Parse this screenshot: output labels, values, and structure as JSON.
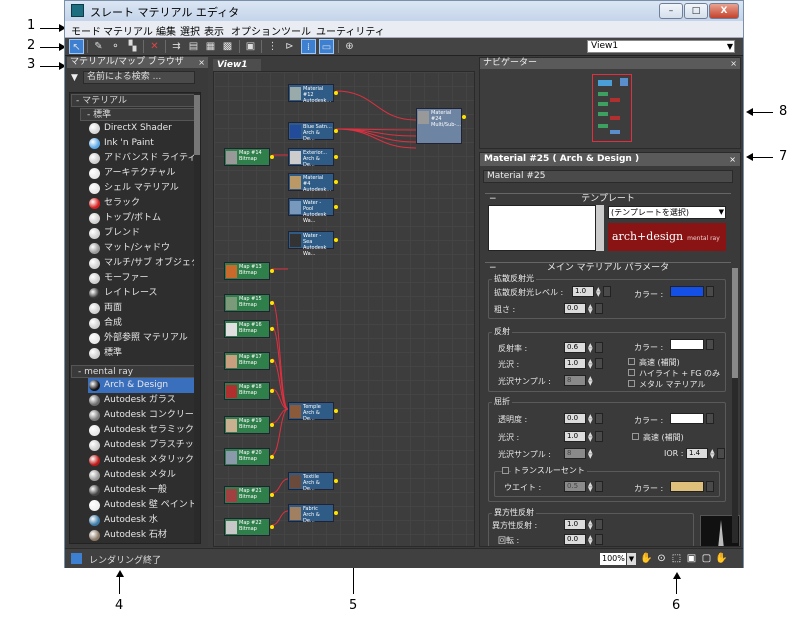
{
  "window": {
    "title": "スレート マテリアル エディタ",
    "buttons": {
      "minimize": "–",
      "maximize": "□",
      "close": "X"
    }
  },
  "menu": [
    "モード",
    "マテリアル",
    "編集",
    "選択",
    "表示",
    "オプション",
    "ツール",
    "ユーティリティ"
  ],
  "toolbar": {
    "icons": [
      "select-icon",
      "eyedropper-icon",
      "assign-icon",
      "pick-icon",
      "delete-icon",
      "move-children-icon",
      "hide-unused-icon",
      "layout-icon",
      "checker-icon",
      "background-icon",
      "show-map-icon",
      "show-end-icon",
      "parameter-icon",
      "zoom-select-icon"
    ],
    "view_select": "View1"
  },
  "browser": {
    "title": "マテリアル/マップ ブラウザ",
    "search_placeholder": "名前による検索 ...",
    "materials_group": "- マテリアル",
    "standard_group": "- 標準",
    "standard_items": [
      {
        "label": "DirectX Shader",
        "color": "#d7d7d7"
      },
      {
        "label": "Ink 'n Paint",
        "color": "#5aa8e6"
      },
      {
        "label": "アドバンスド ライティ...",
        "color": "#cfcfcf"
      },
      {
        "label": "アーキテクチャル",
        "color": "#e8e8e8"
      },
      {
        "label": "シェル マテリアル",
        "color": "#e8e8e8"
      },
      {
        "label": "セラック",
        "color": "#d81e1e"
      },
      {
        "label": "トップ/ボトム",
        "color": "#d0d0d0"
      },
      {
        "label": "ブレンド",
        "color": "#d0d0d0"
      },
      {
        "label": "マット/シャドウ",
        "color": "#9a9a9a"
      },
      {
        "label": "マルチ/サブ オブジェクト",
        "color": "#d0d0d0"
      },
      {
        "label": "モーファー",
        "color": "#d0d0d0"
      },
      {
        "label": "レイトレース",
        "color": "#333333"
      },
      {
        "label": "両面",
        "color": "#d0d0d0"
      },
      {
        "label": "合成",
        "color": "#d0d0d0"
      },
      {
        "label": "外部参照 マテリアル",
        "color": "#e8e8e8"
      },
      {
        "label": "標準",
        "color": "#cfcfcf"
      }
    ],
    "mr_group": "- mental ray",
    "mr_items": [
      {
        "label": "Arch & Design",
        "color": "#111111"
      },
      {
        "label": "Autodesk ガラス",
        "color": "#6a6a6a"
      },
      {
        "label": "Autodesk コンクリート",
        "color": "#7a7a7a"
      },
      {
        "label": "Autodesk セラミック",
        "color": "#e8e8e8"
      },
      {
        "label": "Autodesk プラスチッ...",
        "color": "#cfcfcf"
      },
      {
        "label": "Autodesk メタリック ...",
        "color": "#c01818"
      },
      {
        "label": "Autodesk メタル",
        "color": "#999999"
      },
      {
        "label": "Autodesk 一般",
        "color": "#444444"
      },
      {
        "label": "Autodesk 壁 ペイント",
        "color": "#f0f0f0"
      },
      {
        "label": "Autodesk 水",
        "color": "#3a7aa8"
      },
      {
        "label": "Autodesk 石材",
        "color": "#8a7a66"
      }
    ]
  },
  "view": {
    "tab": "View1",
    "nodes": [
      {
        "line1": "Material #12",
        "line2": "Autodesk..."
      },
      {
        "line1": "Blue Satn...",
        "line2": "Arch & De..."
      },
      {
        "line1": "Map #14",
        "line2": "Bitmap"
      },
      {
        "line1": "Exterior...",
        "line2": "Arch & De..."
      },
      {
        "line1": "Material #4",
        "line2": "Autodesk..."
      },
      {
        "line1": "Water - Pool",
        "line2": "Autodesk Wa..."
      },
      {
        "line1": "Water - Sea",
        "line2": "Autodesk Wa..."
      },
      {
        "line1": "Material #24",
        "line2": "Multi/Sub-..."
      },
      {
        "line1": "Map #13",
        "line2": "Bitmap"
      },
      {
        "line1": "Map #15",
        "line2": "Bitmap"
      },
      {
        "line1": "Map #16",
        "line2": "Bitmap"
      },
      {
        "line1": "Map #17",
        "line2": "Bitmap"
      },
      {
        "line1": "Map #18",
        "line2": "Bitmap"
      },
      {
        "line1": "Map #19",
        "line2": "Bitmap"
      },
      {
        "line1": "Map #20",
        "line2": "Bitmap"
      },
      {
        "line1": "Map #21",
        "line2": "Bitmap"
      },
      {
        "line1": "Map #22",
        "line2": "Bitmap"
      },
      {
        "line1": "Temple",
        "line2": "Arch & De..."
      },
      {
        "line1": "Textile",
        "line2": "Arch & De..."
      },
      {
        "line1": "Fabric",
        "line2": "Arch & De..."
      }
    ]
  },
  "navigator": {
    "title": "ナビゲーター"
  },
  "params": {
    "title": "Material #25  ( Arch & Design )",
    "name": "Material #25",
    "template_rollout": "テンプレート",
    "template_select": "(テンプレートを選択)",
    "logo": "arch+design",
    "logo_sub": "mental ray",
    "main_rollout": "メイン マテリアル パラメータ",
    "diffuse": {
      "title": "拡散反射光",
      "level_label": "拡散反射光レベル :",
      "level": "1.0",
      "roughness_label": "粗さ :",
      "roughness": "0.0",
      "color_label": "カラー :",
      "color": "#1450e6"
    },
    "reflection": {
      "title": "反射",
      "reflectivity_label": "反射率 :",
      "reflectivity": "0.6",
      "gloss_label": "光沢 :",
      "gloss": "1.0",
      "samples_label": "光沢サンプル :",
      "samples": "8",
      "color_label": "カラー :",
      "color": "#ffffff",
      "opt_fast": "高速 (補間)",
      "opt_hl": "ハイライト + FG のみ",
      "opt_metal": "メタル マテリアル"
    },
    "refraction": {
      "title": "屈折",
      "transparency_label": "透明度 :",
      "transparency": "0.0",
      "gloss_label": "光沢 :",
      "gloss": "1.0",
      "samples_label": "光沢サンプル :",
      "samples": "8",
      "color_label": "カラー :",
      "color": "#ffffff",
      "opt_fast": "高速 (補間)",
      "ior_label": "IOR :",
      "ior": "1.4"
    },
    "translucency": {
      "title": "トランスルーセント",
      "weight_label": "ウエイト :",
      "weight": "0.5",
      "color_label": "カラー :",
      "color": "#dfc07a"
    },
    "anisotropy": {
      "title": "異方性反射",
      "aniso_label": "異方性反射 :",
      "aniso": "1.0",
      "rotation_label": "回転 :",
      "rotation": "0.0"
    }
  },
  "status": {
    "text": "レンダリング終了",
    "zoom": "100%"
  },
  "callouts": [
    "1",
    "2",
    "3",
    "4",
    "5",
    "6",
    "7",
    "8"
  ]
}
